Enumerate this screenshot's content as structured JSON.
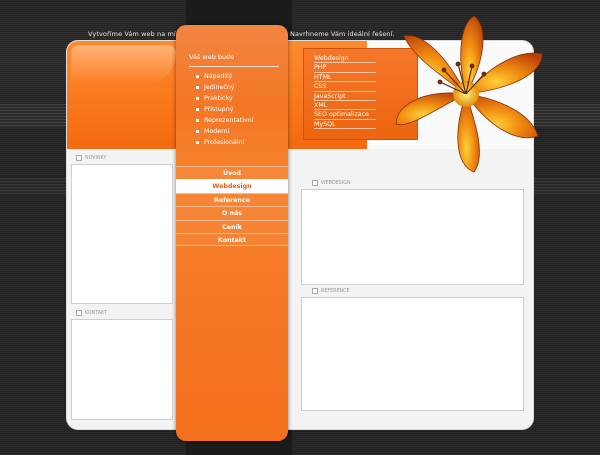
{
  "header": {
    "tagline_left": "Vytvoříme Vám web na míru.",
    "tagline_right": "Navrhneme Vám ideální řešení."
  },
  "features": {
    "title": "Váš web bude",
    "items": [
      "Nápaditý",
      "Jedinečný",
      "Praktický",
      "Přístupný",
      "Reprezentativní",
      "Moderní",
      "Profesionální"
    ]
  },
  "technologies": [
    "Webdesign",
    "PHP",
    "HTML",
    "CSS",
    "JavaScript",
    "XML",
    "SEO optimalizace",
    "MySQL"
  ],
  "menu": {
    "items": [
      "Úvod",
      "Webdesign",
      "Reference",
      "O nás",
      "Ceník",
      "Kontakt"
    ],
    "active": "Webdesign"
  },
  "sections": {
    "news": "NOVINKY",
    "contact": "KONTAKT",
    "webdesign": "WEBDESIGN",
    "reference": "REFERENCE"
  },
  "colors": {
    "accent": "#f36f1c",
    "background": "#262626",
    "panel": "#f3f3f3"
  }
}
